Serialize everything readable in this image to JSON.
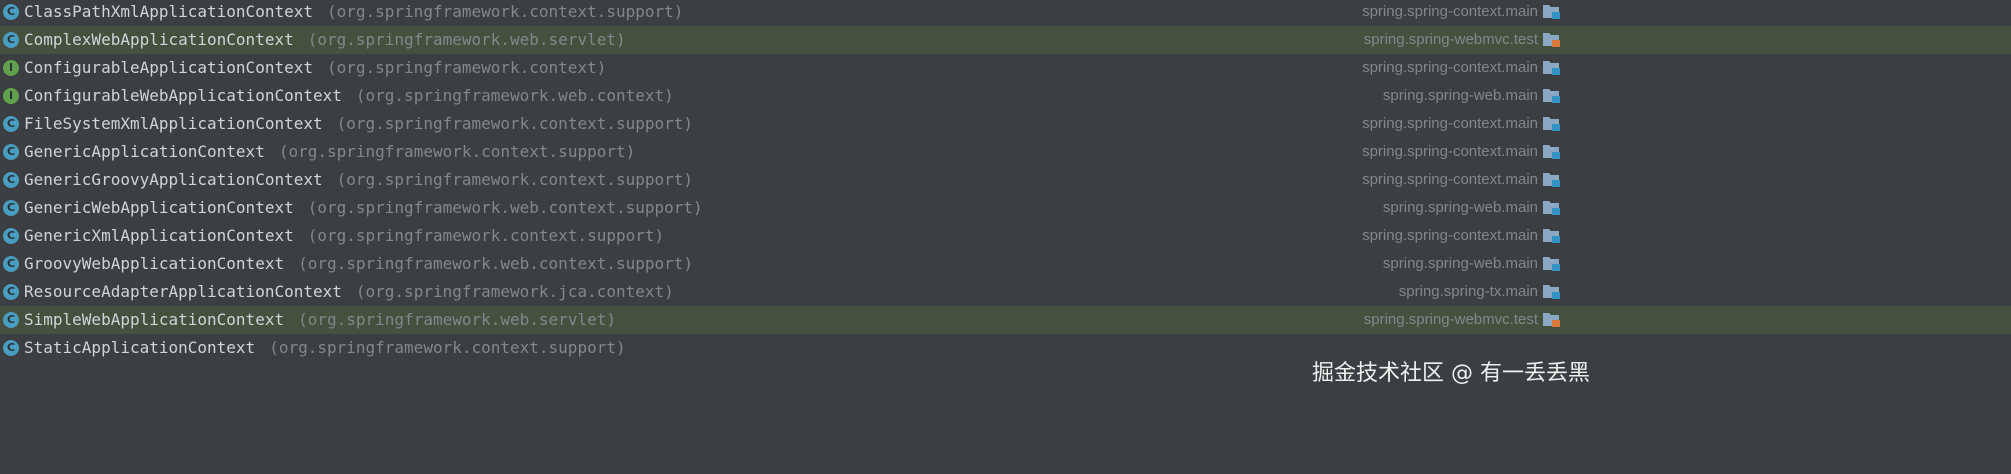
{
  "colors": {
    "background": "#3c3f41",
    "test_row_highlight": "#45503f",
    "class_icon": "#4a9cc0",
    "interface_icon": "#62a04e",
    "name_text": "#d0d4d8",
    "package_text": "#83878b",
    "module_text": "#83878b",
    "folder_icon": "#8aa7c4",
    "source_marker": "#3592c4",
    "test_marker": "#d6783a"
  },
  "icons": {
    "class": "class-icon",
    "interface": "interface-icon",
    "source_folder": "source-folder-icon",
    "test_folder": "test-folder-icon"
  },
  "rows": [
    {
      "kind": "class",
      "kind_letter": "C",
      "name": "ClassPathXmlApplicationContext",
      "package": "(org.springframework.context.support)",
      "module": "spring.spring-context.main",
      "test": false
    },
    {
      "kind": "class",
      "kind_letter": "C",
      "name": "ComplexWebApplicationContext",
      "package": "(org.springframework.web.servlet)",
      "module": "spring.spring-webmvc.test",
      "test": true
    },
    {
      "kind": "interface",
      "kind_letter": "I",
      "name": "ConfigurableApplicationContext",
      "package": "(org.springframework.context)",
      "module": "spring.spring-context.main",
      "test": false
    },
    {
      "kind": "interface",
      "kind_letter": "I",
      "name": "ConfigurableWebApplicationContext",
      "package": "(org.springframework.web.context)",
      "module": "spring.spring-web.main",
      "test": false
    },
    {
      "kind": "class",
      "kind_letter": "C",
      "name": "FileSystemXmlApplicationContext",
      "package": "(org.springframework.context.support)",
      "module": "spring.spring-context.main",
      "test": false
    },
    {
      "kind": "class",
      "kind_letter": "C",
      "name": "GenericApplicationContext",
      "package": "(org.springframework.context.support)",
      "module": "spring.spring-context.main",
      "test": false
    },
    {
      "kind": "class",
      "kind_letter": "C",
      "name": "GenericGroovyApplicationContext",
      "package": "(org.springframework.context.support)",
      "module": "spring.spring-context.main",
      "test": false
    },
    {
      "kind": "class",
      "kind_letter": "C",
      "name": "GenericWebApplicationContext",
      "package": "(org.springframework.web.context.support)",
      "module": "spring.spring-web.main",
      "test": false
    },
    {
      "kind": "class",
      "kind_letter": "C",
      "name": "GenericXmlApplicationContext",
      "package": "(org.springframework.context.support)",
      "module": "spring.spring-context.main",
      "test": false
    },
    {
      "kind": "class",
      "kind_letter": "C",
      "name": "GroovyWebApplicationContext",
      "package": "(org.springframework.web.context.support)",
      "module": "spring.spring-web.main",
      "test": false
    },
    {
      "kind": "class",
      "kind_letter": "C",
      "name": "ResourceAdapterApplicationContext",
      "package": "(org.springframework.jca.context)",
      "module": "spring.spring-tx.main",
      "test": false
    },
    {
      "kind": "class",
      "kind_letter": "C",
      "name": "SimpleWebApplicationContext",
      "package": "(org.springframework.web.servlet)",
      "module": "spring.spring-webmvc.test",
      "test": true
    },
    {
      "kind": "class",
      "kind_letter": "C",
      "name": "StaticApplicationContext",
      "package": "(org.springframework.context.support)",
      "module": "",
      "test": false
    }
  ],
  "watermark": "掘金技术社区 @ 有一丢丢黑"
}
